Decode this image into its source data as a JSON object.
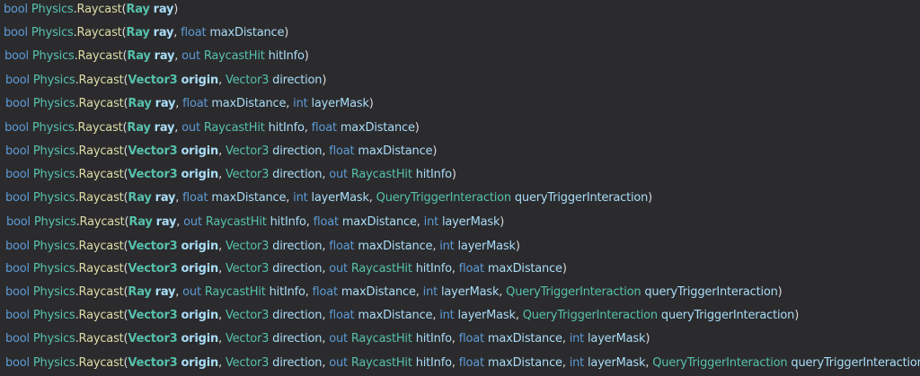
{
  "colors": {
    "background": "#2b2b2d",
    "keyword": "#5d9bd6",
    "class": "#57c2b0",
    "method": "#dcdca8",
    "param": "#a9dcf7",
    "punctuation": "#d8d8d8"
  },
  "overloads": [
    {
      "return_type": "bool",
      "class_name": "Physics",
      "method": "Raycast",
      "params": [
        {
          "type": "Ray",
          "name": "ray"
        }
      ]
    },
    {
      "return_type": "bool",
      "class_name": "Physics",
      "method": "Raycast",
      "params": [
        {
          "type": "Ray",
          "name": "ray"
        },
        {
          "type": "float",
          "name": "maxDistance"
        }
      ]
    },
    {
      "return_type": "bool",
      "class_name": "Physics",
      "method": "Raycast",
      "params": [
        {
          "type": "Ray",
          "name": "ray"
        },
        {
          "modifier": "out",
          "type": "RaycastHit",
          "name": "hitInfo"
        }
      ]
    },
    {
      "return_type": "bool",
      "class_name": "Physics",
      "method": "Raycast",
      "params": [
        {
          "type": "Vector3",
          "name": "origin"
        },
        {
          "type": "Vector3",
          "name": "direction"
        }
      ]
    },
    {
      "return_type": "bool",
      "class_name": "Physics",
      "method": "Raycast",
      "params": [
        {
          "type": "Ray",
          "name": "ray"
        },
        {
          "type": "float",
          "name": "maxDistance"
        },
        {
          "type": "int",
          "name": "layerMask"
        }
      ]
    },
    {
      "return_type": "bool",
      "class_name": "Physics",
      "method": "Raycast",
      "params": [
        {
          "type": "Ray",
          "name": "ray"
        },
        {
          "modifier": "out",
          "type": "RaycastHit",
          "name": "hitInfo"
        },
        {
          "type": "float",
          "name": "maxDistance"
        }
      ]
    },
    {
      "return_type": "bool",
      "class_name": "Physics",
      "method": "Raycast",
      "params": [
        {
          "type": "Vector3",
          "name": "origin"
        },
        {
          "type": "Vector3",
          "name": "direction"
        },
        {
          "type": "float",
          "name": "maxDistance"
        }
      ]
    },
    {
      "return_type": "bool",
      "class_name": "Physics",
      "method": "Raycast",
      "params": [
        {
          "type": "Vector3",
          "name": "origin"
        },
        {
          "type": "Vector3",
          "name": "direction"
        },
        {
          "modifier": "out",
          "type": "RaycastHit",
          "name": "hitInfo"
        }
      ]
    },
    {
      "return_type": "bool",
      "class_name": "Physics",
      "method": "Raycast",
      "params": [
        {
          "type": "Ray",
          "name": "ray"
        },
        {
          "type": "float",
          "name": "maxDistance"
        },
        {
          "type": "int",
          "name": "layerMask"
        },
        {
          "type": "QueryTriggerInteraction",
          "name": "queryTriggerInteraction"
        }
      ]
    },
    {
      "return_type": "bool",
      "class_name": "Physics",
      "method": "Raycast",
      "params": [
        {
          "type": "Ray",
          "name": "ray"
        },
        {
          "modifier": "out",
          "type": "RaycastHit",
          "name": "hitInfo"
        },
        {
          "type": "float",
          "name": "maxDistance"
        },
        {
          "type": "int",
          "name": "layerMask"
        }
      ]
    },
    {
      "return_type": "bool",
      "class_name": "Physics",
      "method": "Raycast",
      "params": [
        {
          "type": "Vector3",
          "name": "origin"
        },
        {
          "type": "Vector3",
          "name": "direction"
        },
        {
          "type": "float",
          "name": "maxDistance"
        },
        {
          "type": "int",
          "name": "layerMask"
        }
      ]
    },
    {
      "return_type": "bool",
      "class_name": "Physics",
      "method": "Raycast",
      "params": [
        {
          "type": "Vector3",
          "name": "origin"
        },
        {
          "type": "Vector3",
          "name": "direction"
        },
        {
          "modifier": "out",
          "type": "RaycastHit",
          "name": "hitInfo"
        },
        {
          "type": "float",
          "name": "maxDistance"
        }
      ]
    },
    {
      "return_type": "bool",
      "class_name": "Physics",
      "method": "Raycast",
      "params": [
        {
          "type": "Ray",
          "name": "ray"
        },
        {
          "modifier": "out",
          "type": "RaycastHit",
          "name": "hitInfo"
        },
        {
          "type": "float",
          "name": "maxDistance"
        },
        {
          "type": "int",
          "name": "layerMask"
        },
        {
          "type": "QueryTriggerInteraction",
          "name": "queryTriggerInteraction"
        }
      ]
    },
    {
      "return_type": "bool",
      "class_name": "Physics",
      "method": "Raycast",
      "params": [
        {
          "type": "Vector3",
          "name": "origin"
        },
        {
          "type": "Vector3",
          "name": "direction"
        },
        {
          "type": "float",
          "name": "maxDistance"
        },
        {
          "type": "int",
          "name": "layerMask"
        },
        {
          "type": "QueryTriggerInteraction",
          "name": "queryTriggerInteraction"
        }
      ]
    },
    {
      "return_type": "bool",
      "class_name": "Physics",
      "method": "Raycast",
      "params": [
        {
          "type": "Vector3",
          "name": "origin"
        },
        {
          "type": "Vector3",
          "name": "direction"
        },
        {
          "modifier": "out",
          "type": "RaycastHit",
          "name": "hitInfo"
        },
        {
          "type": "float",
          "name": "maxDistance"
        },
        {
          "type": "int",
          "name": "layerMask"
        }
      ]
    },
    {
      "return_type": "bool",
      "class_name": "Physics",
      "method": "Raycast",
      "params": [
        {
          "type": "Vector3",
          "name": "origin"
        },
        {
          "type": "Vector3",
          "name": "direction"
        },
        {
          "modifier": "out",
          "type": "RaycastHit",
          "name": "hitInfo"
        },
        {
          "type": "float",
          "name": "maxDistance"
        },
        {
          "type": "int",
          "name": "layerMask"
        },
        {
          "type": "QueryTriggerInteraction",
          "name": "queryTriggerInteraction"
        }
      ]
    }
  ]
}
